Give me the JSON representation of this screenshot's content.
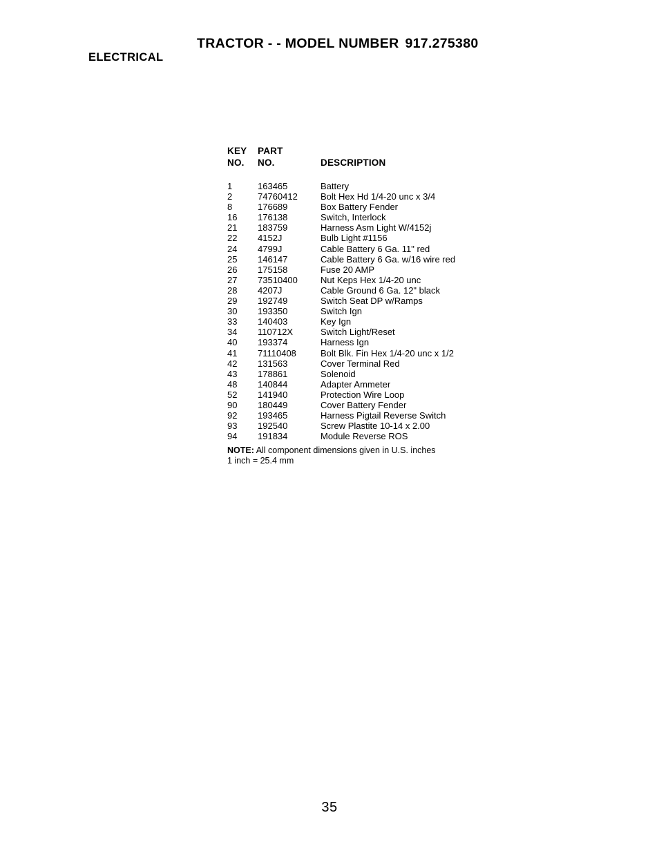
{
  "header": {
    "doc_title_main": "TRACTOR - - MODEL NUMBER",
    "model_number": "917.275380",
    "section_label": "ELECTRICAL"
  },
  "table": {
    "headers": {
      "key_line1": "KEY",
      "key_line2": "NO.",
      "part_line1": "PART",
      "part_line2": "NO.",
      "description": "DESCRIPTION"
    },
    "rows": [
      {
        "key_no": "1",
        "part_no": "163465",
        "description": "Battery"
      },
      {
        "key_no": "2",
        "part_no": "74760412",
        "description": "Bolt Hex Hd 1/4-20 unc x 3/4"
      },
      {
        "key_no": "8",
        "part_no": "176689",
        "description": "Box Battery Fender"
      },
      {
        "key_no": "16",
        "part_no": "176138",
        "description": "Switch, Interlock"
      },
      {
        "key_no": "21",
        "part_no": "183759",
        "description": "Harness Asm Light W/4152j"
      },
      {
        "key_no": "22",
        "part_no": "4152J",
        "description": "Bulb Light #1156"
      },
      {
        "key_no": "24",
        "part_no": "4799J",
        "description": "Cable Battery 6 Ga. 11\" red"
      },
      {
        "key_no": "25",
        "part_no": "146147",
        "description": "Cable Battery 6 Ga. w/16 wire red"
      },
      {
        "key_no": "26",
        "part_no": "175158",
        "description": "Fuse 20 AMP"
      },
      {
        "key_no": "27",
        "part_no": "73510400",
        "description": "Nut Keps Hex 1/4-20 unc"
      },
      {
        "key_no": "28",
        "part_no": "4207J",
        "description": "Cable Ground 6 Ga. 12\" black"
      },
      {
        "key_no": "29",
        "part_no": "192749",
        "description": "Switch Seat DP w/Ramps"
      },
      {
        "key_no": "30",
        "part_no": "193350",
        "description": "Switch Ign"
      },
      {
        "key_no": "33",
        "part_no": "140403",
        "description": "Key Ign"
      },
      {
        "key_no": "34",
        "part_no": "110712X",
        "description": "Switch Light/Reset"
      },
      {
        "key_no": "40",
        "part_no": "193374",
        "description": "Harness Ign"
      },
      {
        "key_no": "41",
        "part_no": "71110408",
        "description": "Bolt Blk. Fin Hex 1/4-20 unc x 1/2"
      },
      {
        "key_no": "42",
        "part_no": "131563",
        "description": "Cover Terminal Red"
      },
      {
        "key_no": "43",
        "part_no": "178861",
        "description": "Solenoid"
      },
      {
        "key_no": "48",
        "part_no": "140844",
        "description": "Adapter Ammeter"
      },
      {
        "key_no": "52",
        "part_no": "141940",
        "description": "Protection Wire Loop"
      },
      {
        "key_no": "90",
        "part_no": "180449",
        "description": "Cover Battery Fender"
      },
      {
        "key_no": "92",
        "part_no": "193465",
        "description": "Harness Pigtail Reverse Switch"
      },
      {
        "key_no": "93",
        "part_no": "192540",
        "description": "Screw Plastite 10-14 x 2.00"
      },
      {
        "key_no": "94",
        "part_no": "191834",
        "description": "Module Reverse ROS"
      }
    ]
  },
  "note": {
    "label": "NOTE:",
    "line1": "All component dimensions given in U.S. inches",
    "line2": "1 inch = 25.4 mm"
  },
  "footer": {
    "page_number": "35"
  }
}
